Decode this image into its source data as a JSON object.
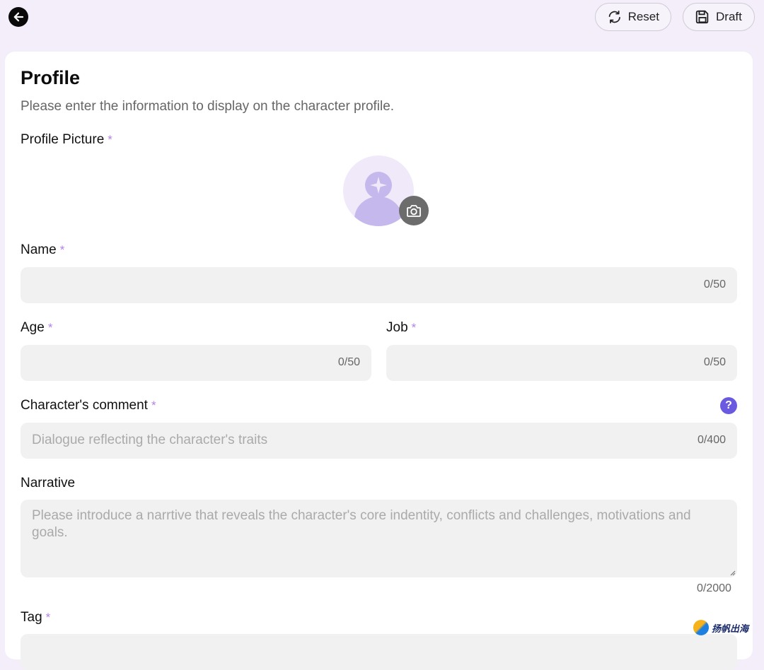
{
  "toolbar": {
    "back_icon": "arrow-left-icon",
    "reset_label": "Reset",
    "draft_label": "Draft"
  },
  "form": {
    "title": "Profile",
    "subtitle": "Please enter the information to display on the character profile.",
    "required_mark": "*",
    "profile_picture": {
      "label": "Profile Picture"
    },
    "name": {
      "label": "Name",
      "value": "",
      "counter": "0/50"
    },
    "age": {
      "label": "Age",
      "value": "",
      "counter": "0/50"
    },
    "job": {
      "label": "Job",
      "value": "",
      "counter": "0/50"
    },
    "comment": {
      "label": "Character's comment",
      "placeholder": "Dialogue reflecting the character's traits",
      "counter": "0/400",
      "help_icon_text": "?"
    },
    "narrative": {
      "label": "Narrative",
      "placeholder": "Please introduce a narrtive that reveals the character's core indentity, conflicts and challenges, motivations and goals.",
      "counter": "0/2000"
    },
    "tag": {
      "label": "Tag"
    }
  },
  "watermark": {
    "text": "扬帆出海"
  },
  "colors": {
    "background": "#f3eef9",
    "required": "#b482e8",
    "help_icon": "#6a5ae0",
    "avatar_fill": "#c5b8ec"
  }
}
